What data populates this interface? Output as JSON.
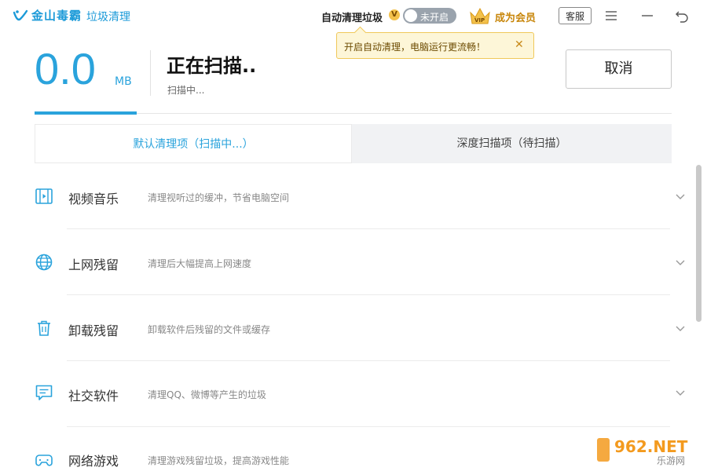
{
  "app": {
    "brand": "金山毒霸",
    "module": "垃圾清理"
  },
  "header": {
    "auto_clean_label": "自动清理垃圾",
    "vip_mark": "V",
    "toggle_text": "未开启",
    "vip_button": "成为会员",
    "vip_crown_text": "VIP",
    "service_button": "客服",
    "tooltip_text": "开启自动清理，电脑运行更流畅！",
    "tooltip_close": "✕"
  },
  "scan": {
    "size_value": "0.0",
    "size_unit": "MB",
    "title": "正在扫描..",
    "subtitle": "扫描中...",
    "cancel_label": "取消"
  },
  "tabs": [
    {
      "label": "默认清理项（扫描中...）",
      "active": true
    },
    {
      "label": "深度扫描项（待扫描）",
      "active": false
    }
  ],
  "items": [
    {
      "name": "视频音乐",
      "desc": "清理视听过的缓冲，节省电脑空间",
      "icon": "film-icon"
    },
    {
      "name": "上网残留",
      "desc": "清理后大幅提高上网速度",
      "icon": "globe-icon"
    },
    {
      "name": "卸载残留",
      "desc": "卸载软件后残留的文件或缓存",
      "icon": "trash-icon"
    },
    {
      "name": "社交软件",
      "desc": "清理QQ、微博等产生的垃圾",
      "icon": "chat-icon"
    },
    {
      "name": "网络游戏",
      "desc": "清理游戏残留垃圾，提高游戏性能",
      "icon": "gamepad-icon"
    }
  ],
  "watermark": {
    "brand": "962.NET",
    "sub": "乐游网"
  },
  "colors": {
    "accent": "#2aa3dc",
    "tooltip_bg": "#fdf6d8",
    "vip_gold": "#f3c14b"
  }
}
